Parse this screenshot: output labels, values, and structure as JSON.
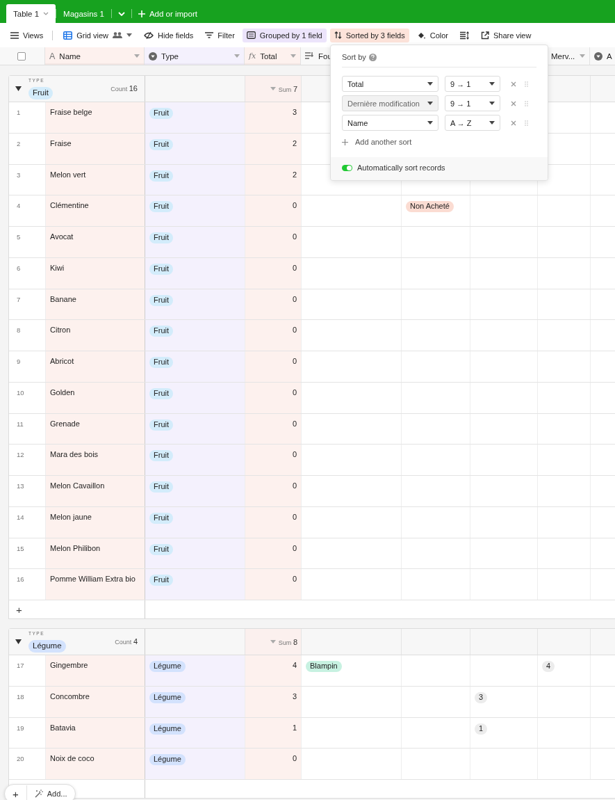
{
  "tabs": [
    {
      "label": "Table 1",
      "selected": true
    },
    {
      "label": "Magasins 1",
      "selected": false
    }
  ],
  "tabs_more": {
    "kind": "more"
  },
  "add_tab": {
    "label": "Add or import"
  },
  "toolbar": [
    {
      "kind": "views",
      "label": "Views",
      "active": false
    },
    {
      "kind": "grid",
      "label": "Grid view",
      "active": false
    },
    {
      "kind": "hide",
      "label": "Hide fields",
      "active": false
    },
    {
      "kind": "filter",
      "label": "Filter",
      "active": false
    },
    {
      "kind": "group",
      "label": "Grouped by 1 field",
      "active": true,
      "color": "#ece4fb"
    },
    {
      "kind": "sort",
      "label": "Sorted by 3 fields",
      "active": true,
      "color": "#fde3da"
    },
    {
      "kind": "color",
      "label": "Color",
      "active": false
    },
    {
      "kind": "rowheight",
      "active": false
    },
    {
      "kind": "share",
      "label": "Share view",
      "active": false
    }
  ],
  "select_all": {
    "checked": false
  },
  "columns": [
    {
      "kind": "text",
      "glyph": "A",
      "label": "Name",
      "sorted": true,
      "grouped": false,
      "caret": true
    },
    {
      "kind": "select",
      "label": "Type",
      "sorted": false,
      "grouped": true,
      "caret": true
    },
    {
      "kind": "formula",
      "glyph": "fx",
      "label": "Total",
      "sorted": true,
      "grouped": false,
      "caret": true
    },
    {
      "kind": "lookup",
      "label": "Fou",
      "sorted": false,
      "grouped": false,
      "caret": false
    },
    {
      "kind": "plain",
      "label": "Merv...",
      "sorted": false,
      "grouped": false,
      "caret": true
    },
    {
      "kind": "select",
      "label": "A",
      "sorted": false,
      "grouped": false,
      "caret": false
    }
  ],
  "groups": [
    {
      "caption": "TYPE",
      "value": "Fruit",
      "color": "#d3ecfb",
      "expanded": true,
      "count_label": "Count",
      "count": "16",
      "sum_label": "Sum",
      "sum": "7",
      "add_label": "+",
      "rows": [
        {
          "number": "1",
          "name": "Fraise belge",
          "type": "Fruit",
          "total": "3"
        },
        {
          "number": "2",
          "name": "Fraise",
          "type": "Fruit",
          "total": "2"
        },
        {
          "number": "3",
          "name": "Melon vert",
          "type": "Fruit",
          "total": "2"
        },
        {
          "number": "4",
          "name": "Clémentine",
          "type": "Fruit",
          "total": "0",
          "column_5": {
            "text": "Non Acheté",
            "color": "#fbdcd2"
          }
        },
        {
          "number": "5",
          "name": "Avocat",
          "type": "Fruit",
          "total": "0"
        },
        {
          "number": "6",
          "name": "Kiwi",
          "type": "Fruit",
          "total": "0"
        },
        {
          "number": "7",
          "name": "Banane",
          "type": "Fruit",
          "total": "0"
        },
        {
          "number": "8",
          "name": "Citron",
          "type": "Fruit",
          "total": "0"
        },
        {
          "number": "9",
          "name": "Abricot",
          "type": "Fruit",
          "total": "0"
        },
        {
          "number": "10",
          "name": "Golden",
          "type": "Fruit",
          "total": "0"
        },
        {
          "number": "11",
          "name": "Grenade",
          "type": "Fruit",
          "total": "0"
        },
        {
          "number": "12",
          "name": "Mara des bois",
          "type": "Fruit",
          "total": "0"
        },
        {
          "number": "13",
          "name": "Melon Cavaillon",
          "type": "Fruit",
          "total": "0"
        },
        {
          "number": "14",
          "name": "Melon jaune",
          "type": "Fruit",
          "total": "0"
        },
        {
          "number": "15",
          "name": "Melon Philibon",
          "type": "Fruit",
          "total": "0"
        },
        {
          "number": "16",
          "name": "Pomme William Extra bio",
          "type": "Fruit",
          "total": "0"
        }
      ]
    },
    {
      "caption": "TYPE",
      "value": "Légume",
      "color": "#d3e2fd",
      "expanded": true,
      "count_label": "Count",
      "count": "4",
      "sum_label": "Sum",
      "sum": "8",
      "rows": [
        {
          "number": "17",
          "name": "Gingembre",
          "type": "Légume",
          "total": "4",
          "column_4": {
            "text": "Blampin",
            "color": "#c7f1e1"
          },
          "column_7": {
            "text": "4",
            "color": "#ececec"
          }
        },
        {
          "number": "18",
          "name": "Concombre",
          "type": "Légume",
          "total": "3",
          "column_6": {
            "text": "3",
            "color": "#ececec"
          }
        },
        {
          "number": "19",
          "name": "Batavia",
          "type": "Légume",
          "total": "1",
          "column_6": {
            "text": "1",
            "color": "#ececec"
          }
        },
        {
          "number": "20",
          "name": "Noix de coco",
          "type": "Légume",
          "total": "0"
        }
      ]
    }
  ],
  "sort_popup": {
    "title": "Sort by",
    "sorts": [
      {
        "field": "Total",
        "direction": "9 → 1",
        "disabled": false
      },
      {
        "field": "Dernière modification",
        "direction": "9 → 1",
        "disabled": true
      },
      {
        "field": "Name",
        "direction": "A → Z",
        "disabled": false
      }
    ],
    "add_label": "Add another sort",
    "auto_sort": {
      "label": "Automatically sort records",
      "on": true
    }
  },
  "bottom_bar": {
    "add": "+",
    "more": "Add..."
  }
}
